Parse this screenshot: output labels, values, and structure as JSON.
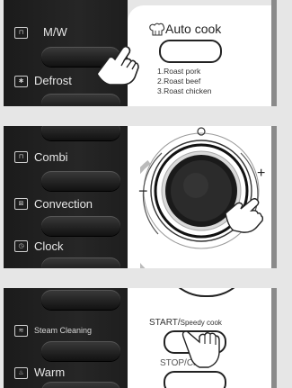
{
  "panel1": {
    "buttons": [
      {
        "label": "M/W",
        "icon": "microwave-icon"
      },
      {
        "label": "Defrost",
        "icon": "defrost-icon"
      }
    ],
    "auto_cook": {
      "title": "Auto cook",
      "icon": "chef-hat-icon",
      "menu": [
        "1.Roast pork",
        "2.Roast beef",
        "3.Roast chicken"
      ]
    }
  },
  "panel2": {
    "buttons": [
      {
        "label": "Combi",
        "icon": "combi-icon"
      },
      {
        "label": "Convection",
        "icon": "convection-icon"
      },
      {
        "label": "Clock",
        "icon": "clock-icon"
      }
    ],
    "dial": {
      "minus": "−",
      "plus": "+"
    }
  },
  "panel3": {
    "buttons": [
      {
        "label": "Steam Cleaning",
        "icon": "steam-cleaning-icon"
      },
      {
        "label": "Warm",
        "icon": "warm-icon"
      }
    ],
    "start_label": "START/",
    "start_sub": "Speedy cook",
    "stop_label": "STOP/Clear"
  },
  "colors": {
    "panel_dark": "#1e1e1e",
    "panel_light": "#ffffff",
    "background": "#e6e6e6"
  }
}
